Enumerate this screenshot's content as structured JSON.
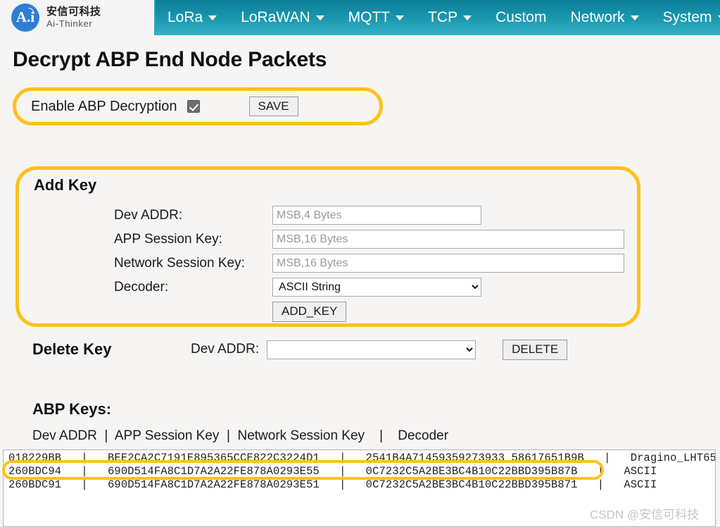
{
  "navbar": {
    "logo": {
      "mark_text": "A.i",
      "cn_name": "安信可科技",
      "en_name": "Ai-Thinker"
    },
    "items": [
      {
        "label": "LoRa",
        "has_caret": true
      },
      {
        "label": "LoRaWAN",
        "has_caret": true
      },
      {
        "label": "MQTT",
        "has_caret": true
      },
      {
        "label": "TCP",
        "has_caret": true
      },
      {
        "label": "Custom",
        "has_caret": false
      },
      {
        "label": "Network",
        "has_caret": true
      },
      {
        "label": "System",
        "has_caret": true
      }
    ]
  },
  "page": {
    "title": "Decrypt ABP End Node Packets"
  },
  "enable_section": {
    "label": "Enable ABP Decryption",
    "checked": true,
    "save_label": "SAVE"
  },
  "add_key": {
    "title": "Add Key",
    "fields": [
      {
        "label": "Dev ADDR:",
        "placeholder": "MSB,4 Bytes",
        "value": ""
      },
      {
        "label": "APP Session Key:",
        "placeholder": "MSB,16 Bytes",
        "value": ""
      },
      {
        "label": "Network Session Key:",
        "placeholder": "MSB,16 Bytes",
        "value": ""
      }
    ],
    "decoder_label": "Decoder:",
    "decoder_value": "ASCII String",
    "decoder_options": [
      "ASCII String"
    ],
    "add_button": "ADD_KEY"
  },
  "delete_key": {
    "title": "Delete Key",
    "dev_addr_label": "Dev ADDR:",
    "dev_addr_value": "",
    "dev_addr_options": [
      ""
    ],
    "delete_button": "DELETE"
  },
  "abp_keys": {
    "title": "ABP Keys:",
    "column_header": "Dev ADDR  |  APP Session Key  |  Network Session Key    |    Decoder",
    "columns": [
      "Dev ADDR",
      "APP Session Key",
      "Network Session Key",
      "Decoder"
    ],
    "rows": [
      {
        "dev_addr": "018229BB",
        "app_session_key": "BEE2CA2C7191E895365CCE822C3224D1",
        "network_session_key": "2541B4A714593592739335 8617651B9B",
        "decoder": "Dragino_LHT65",
        "highlighted": false,
        "text": "018229BB   |   BEE2CA2C7191E895365CCE822C3224D1   |   2541B4A71459359273933 58617651B9B   |   Dragino_LHT65"
      },
      {
        "dev_addr": "260BDC94",
        "app_session_key": "690D514FA8C1D7A2A22FE878A0293E55",
        "network_session_key": "0C7232C5A2BE3BC4B10C22BBD395B87B",
        "decoder": "ASCII",
        "highlighted": true,
        "text": "260BDC94   |   690D514FA8C1D7A2A22FE878A0293E55   |   0C7232C5A2BE3BC4B10C22BBD395B87B   |   ASCII"
      },
      {
        "dev_addr": "260BDC91",
        "app_session_key": "690D514FA8C1D7A2A22FE878A0293E51",
        "network_session_key": "0C7232C5A2BE3BC4B10C22BBD395B871",
        "decoder": "ASCII",
        "highlighted": false,
        "text": "260BDC91   |   690D514FA8C1D7A2A22FE878A0293E51   |   0C7232C5A2BE3BC4B10C22BBD395B871   |   ASCII"
      }
    ]
  },
  "watermark": "CSDN @安信可科技",
  "colors": {
    "nav_top": "#0d7e96",
    "nav_bottom": "#35b2c4",
    "highlight_ring": "#fcc21b",
    "page_bg": "#f7f5f3",
    "logo_blue": "#2e7fd4"
  }
}
